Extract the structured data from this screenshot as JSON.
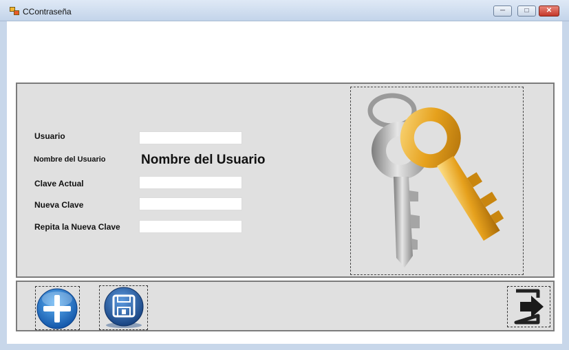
{
  "window": {
    "title": "CContraseña",
    "controls": {
      "minimize": "",
      "maximize": "",
      "close": ""
    }
  },
  "form": {
    "labels": {
      "usuario": "Usuario",
      "nombre_usuario": "Nombre del Usuario",
      "clave_actual": "Clave Actual",
      "nueva_clave": "Nueva Clave",
      "repita_nueva_clave": "Repita la Nueva Clave"
    },
    "values": {
      "usuario": "",
      "nombre_usuario_display": "Nombre del Usuario",
      "clave_actual": "",
      "nueva_clave": "",
      "repita_nueva_clave": ""
    }
  },
  "toolbar": {
    "icons": [
      "add-icon",
      "save-icon",
      "exit-icon"
    ]
  },
  "picture": {
    "icon": "keys-icon"
  },
  "colors": {
    "panel": "#e0e0e0",
    "add_blue": "#1b74c9",
    "save_blue": "#1a4f9a",
    "close_red": "#c4382a",
    "key_gold": "#e6a11d",
    "key_silver": "#b8b8b8"
  }
}
